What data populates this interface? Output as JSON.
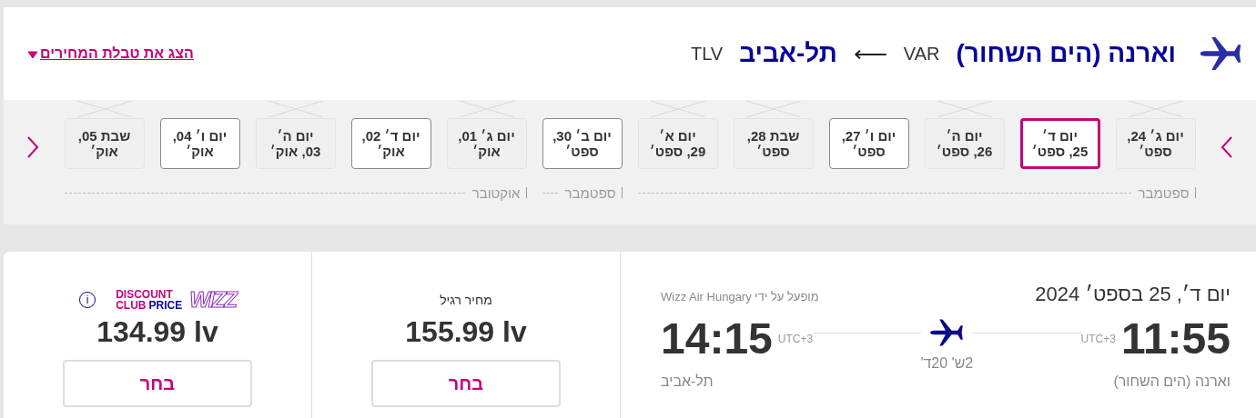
{
  "header": {
    "origin": "וארנה (הים השחור)",
    "origin_code": "VAR",
    "arrow": "⟵",
    "destination": "תל-אביב",
    "destination_code": "TLV",
    "price_table_link": "הצג את טבלת המחירים"
  },
  "date_strip": {
    "months": [
      {
        "label": "ספטמבר",
        "dates": [
          {
            "line1": "יום ג׳ 24,",
            "line2": "ספט׳",
            "available": false,
            "selected": false
          },
          {
            "line1": "יום ד׳",
            "line2": "25, ספט׳",
            "available": true,
            "selected": true
          },
          {
            "line1": "יום ה׳",
            "line2": "26, ספט׳",
            "available": false,
            "selected": false
          },
          {
            "line1": "יום ו׳ 27,",
            "line2": "ספט׳",
            "available": true,
            "selected": false
          },
          {
            "line1": "שבת 28,",
            "line2": "ספט׳",
            "available": false,
            "selected": false
          },
          {
            "line1": "יום א׳",
            "line2": "29, ספט׳",
            "available": false,
            "selected": false
          }
        ]
      },
      {
        "label": "ספטמבר",
        "dates": [
          {
            "line1": "יום ב׳ 30,",
            "line2": "ספט׳",
            "available": true,
            "selected": false
          }
        ]
      },
      {
        "label": "אוקטובר",
        "dates": [
          {
            "line1": "יום ג׳ 01,",
            "line2": "אוק׳",
            "available": false,
            "selected": false
          },
          {
            "line1": "יום ד׳ 02,",
            "line2": "אוק׳",
            "available": true,
            "selected": false
          },
          {
            "line1": "יום ה׳",
            "line2": "03, אוק׳",
            "available": false,
            "selected": false
          },
          {
            "line1": "יום ו׳ 04,",
            "line2": "אוק׳",
            "available": true,
            "selected": false
          },
          {
            "line1": "שבת 05,",
            "line2": "אוק׳",
            "available": false,
            "selected": false
          }
        ]
      }
    ]
  },
  "flight": {
    "date": "יום ד׳, 25 בספט׳ 2024",
    "operator": "מופעל על ידי Wizz Air Hungary",
    "departure_time": "11:55",
    "departure_tz": "UTC+3",
    "departure_city": "וארנה (הים השחור)",
    "duration": "2ש' 20ד'",
    "arrival_time": "14:15",
    "arrival_tz": "UTC+3",
    "arrival_city": "תל-אביב"
  },
  "fares": [
    {
      "kind": "regular",
      "label": "מחיר רגיל",
      "price": "155.99 lv",
      "button": "בחר"
    },
    {
      "kind": "club",
      "logo": "WIZZ",
      "line1": "DISCOUNT",
      "line2a": "CLUB",
      "line2b": "PRICE",
      "info": "i",
      "price": "134.99 lv",
      "button": "בחר"
    }
  ]
}
